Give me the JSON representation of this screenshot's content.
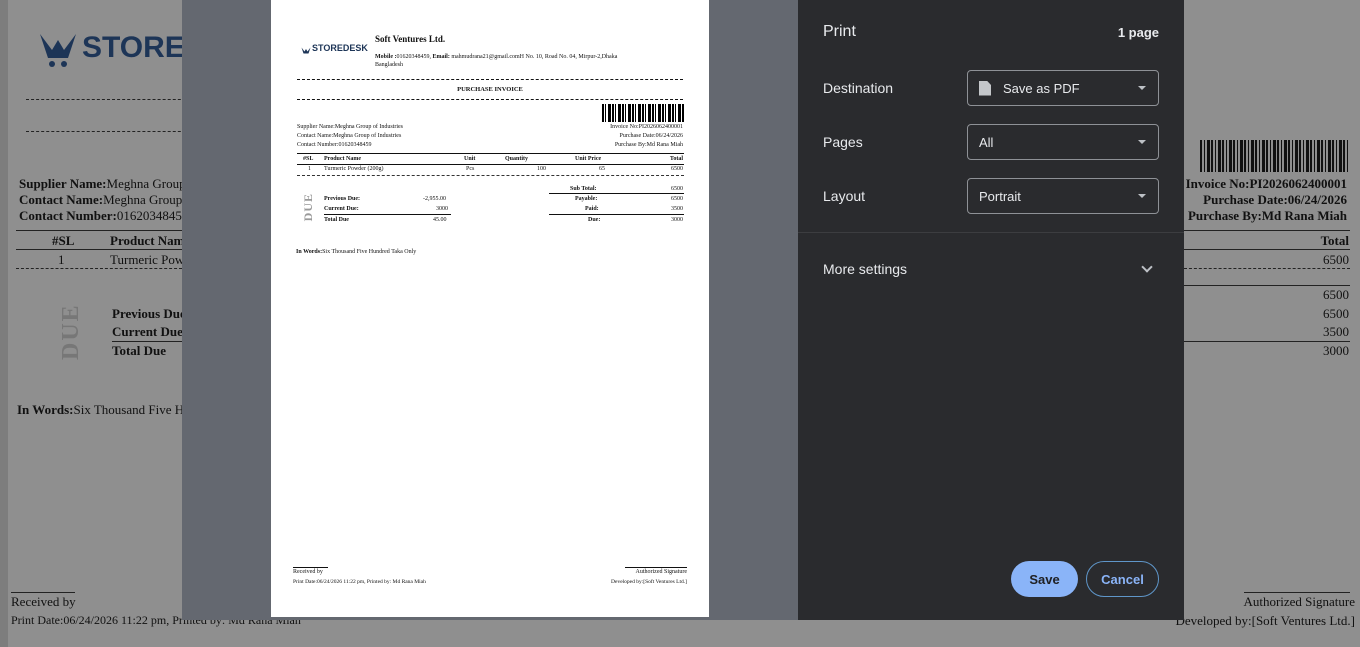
{
  "background_page": {
    "logo_text": "STORE",
    "supplier_name_label": "Supplier Name:",
    "supplier_name_value": "Meghna Group",
    "contact_name_label": "Contact Name:",
    "contact_name_value": "Meghna Group",
    "contact_number_label": "Contact Number:",
    "contact_number_value": "01620348459",
    "col_sl": "#SL",
    "col_product": "Product Nam",
    "row_sl": "1",
    "row_product": "Turmeric Pow",
    "due_stamp": "DUE",
    "previous_due_label": "Previous Due",
    "current_due_label": "Current Due",
    "total_due_label": "Total Due",
    "in_words_label": "In Words:",
    "in_words_value": "Six Thousand Five H",
    "received_by": "Received by",
    "print_date": "Print Date:06/24/2026 11:22 pm, Printed by: Md Rana Miah",
    "invoice_no": "Invoice No:PI2026062400001",
    "purchase_date": "Purchase Date:06/24/2026",
    "purchase_by": "Purchase By:Md Rana Miah",
    "col_total": "Total",
    "row_total": "6500",
    "sum_1": "6500",
    "sum_2": "6500",
    "sum_3": "3500",
    "sum_4": "3000",
    "authorized_signature": "Authorized Signature",
    "developed_by": "Developed by:[Soft Ventures Ltd.]"
  },
  "preview": {
    "logo_text": "STOREDESK",
    "company_name": "Soft Ventures Ltd.",
    "mobile_label": "Mobile :",
    "mobile_value": "01620348459,",
    "email_label": "Email:",
    "email_value": "mahmudrana21@gmail.comH No. 10, Road No. 04, Mirpur-2,Dhaka",
    "address_line2": "Bangladesh",
    "document_title": "PURCHASE INVOICE",
    "supplier_name": "Supplier Name:Meghna Group of Industries",
    "contact_name": "Contact Name:Meghna Group of Industries",
    "contact_number": "Contact Number:01620348459",
    "invoice_no": "Invoice No:PI2026062400001",
    "purchase_date": "Purchase Date:06/24/2026",
    "purchase_by": "Purchase By:Md Rana Miah",
    "table_headers": [
      "#SL",
      "Product Name",
      "Unit",
      "Quantity",
      "Unit Price",
      "Total"
    ],
    "table_rows": [
      [
        "1",
        "Turmeric Powder (200g)",
        "Pcs",
        "100",
        "65",
        "6500"
      ]
    ],
    "due_stamp": "DUE",
    "previous_due_label": "Previous Due:",
    "previous_due_value": "-2,955.00",
    "current_due_label": "Current Due:",
    "current_due_value": "3000",
    "total_due_label": "Total Due",
    "total_due_value": "45.00",
    "sub_total_label": "Sub Total:",
    "sub_total_value": "6500",
    "payable_label": "Payable:",
    "payable_value": "6500",
    "paid_label": "Paid:",
    "paid_value": "3500",
    "due_label": "Due:",
    "due_value": "3000",
    "in_words_label": "In Words:",
    "in_words_value": "Six Thousand Five Hundred Taka Only",
    "received_by": "Received by",
    "print_date": "Print Date:06/24/2026 11:22 pm, Printed by: Md Rana Miah",
    "authorized_signature": "Authorized Signature",
    "developed_by": "Developed by:[Soft Ventures Ltd.]"
  },
  "settings": {
    "title": "Print",
    "page_count": "1 page",
    "destination_label": "Destination",
    "destination_value": "Save as PDF",
    "pages_label": "Pages",
    "pages_value": "All",
    "layout_label": "Layout",
    "layout_value": "Portrait",
    "more_settings": "More settings",
    "save_button": "Save",
    "cancel_button": "Cancel"
  },
  "colors": {
    "dialog_bg": "#2a2b2e",
    "preview_bg": "#646870",
    "accent": "#8ab4f8",
    "logo_blue": "#1d3557"
  }
}
